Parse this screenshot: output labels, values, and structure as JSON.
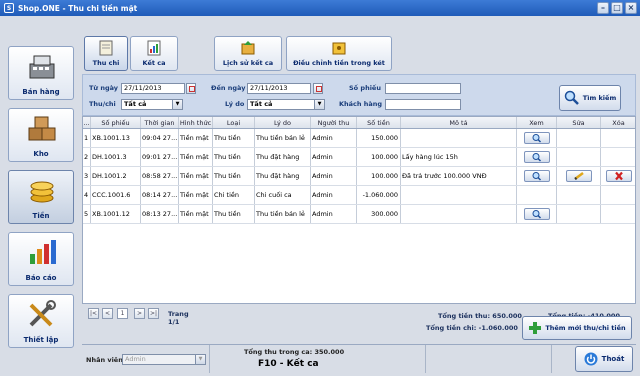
{
  "window": {
    "title": "Shop.ONE - Thu chi tiền mặt",
    "app_icon": "S"
  },
  "nav": [
    {
      "label": "Bán hàng",
      "icon": "cash-register-icon"
    },
    {
      "label": "Kho",
      "icon": "boxes-icon"
    },
    {
      "label": "Tiền",
      "icon": "coins-icon",
      "active": true
    },
    {
      "label": "Báo cáo",
      "icon": "bar-chart-icon"
    },
    {
      "label": "Thiết lập",
      "icon": "tools-icon"
    }
  ],
  "tabs": [
    {
      "label": "Thu chi",
      "active": true
    },
    {
      "label": "Kết ca"
    },
    {
      "label": "Lịch sử kết ca"
    },
    {
      "label": "Điều chỉnh tiền trong két"
    }
  ],
  "filter": {
    "from_label": "Từ ngày",
    "from_value": "27/11/2013",
    "to_label": "Đến ngày",
    "to_value": "27/11/2013",
    "voucher_label": "Số phiếu",
    "voucher_value": "",
    "type_label": "Thu/chi",
    "type_value": "Tất cả",
    "reason_label": "Lý do",
    "reason_value": "Tất cả",
    "customer_label": "Khách hàng",
    "customer_value": "",
    "search_label": "Tìm kiếm"
  },
  "table": {
    "headers": [
      "...",
      "Số phiếu",
      "Thời gian",
      "Hình thức",
      "Loại",
      "Lý do",
      "Người thu",
      "Số tiền",
      "Mô tả",
      "Xem",
      "Sửa",
      "Xóa"
    ],
    "rows": [
      {
        "n": "1",
        "so": "XB.1001.13",
        "time": "09:04 27...",
        "ht": "Tiền mặt",
        "loai": "Thu tiền",
        "lydo": "Thu tiền bán lẻ",
        "nguoi": "Admin",
        "tien": "150.000",
        "mota": "",
        "view": true,
        "edit": false,
        "del": false
      },
      {
        "n": "2",
        "so": "DH.1001.3",
        "time": "09:01 27...",
        "ht": "Tiền mặt",
        "loai": "Thu tiền",
        "lydo": "Thu đặt hàng",
        "nguoi": "Admin",
        "tien": "100.000",
        "mota": "Lấy hàng lúc 15h",
        "view": true,
        "edit": false,
        "del": false
      },
      {
        "n": "3",
        "so": "DH.1001.2",
        "time": "08:58 27...",
        "ht": "Tiền mặt",
        "loai": "Thu tiền",
        "lydo": "Thu đặt hàng",
        "nguoi": "Admin",
        "tien": "100.000",
        "mota": "Đã trả trước 100.000 VNĐ",
        "view": true,
        "edit": true,
        "del": true
      },
      {
        "n": "4",
        "so": "CCC.1001.6",
        "time": "08:14 27...",
        "ht": "Tiền mặt",
        "loai": "Chi tiền",
        "lydo": "Chi cuối ca",
        "nguoi": "Admin",
        "tien": "-1.060.000",
        "mota": "",
        "view": false,
        "edit": false,
        "del": false
      },
      {
        "n": "5",
        "so": "XB.1001.12",
        "time": "08:13 27...",
        "ht": "Tiền mặt",
        "loai": "Thu tiền",
        "lydo": "Thu tiền bán lẻ",
        "nguoi": "Admin",
        "tien": "300.000",
        "mota": "",
        "view": true,
        "edit": false,
        "del": false
      }
    ]
  },
  "pager": {
    "page": "1",
    "label": "Trang 1/1"
  },
  "totals": {
    "thu": "Tổng tiền thu: 650.000",
    "chi": "Tổng tiền chi: -1.060.000",
    "tong": "Tổng tiền: -410.000"
  },
  "add_label": "Thêm mới thu/chi tiền",
  "status": {
    "staff_label": "Nhân viên",
    "staff_value": "Admin",
    "shift_total": "Tổng thu trong ca: 350.000",
    "f10": "F10 - Kết ca"
  },
  "exit_label": "Thoát"
}
